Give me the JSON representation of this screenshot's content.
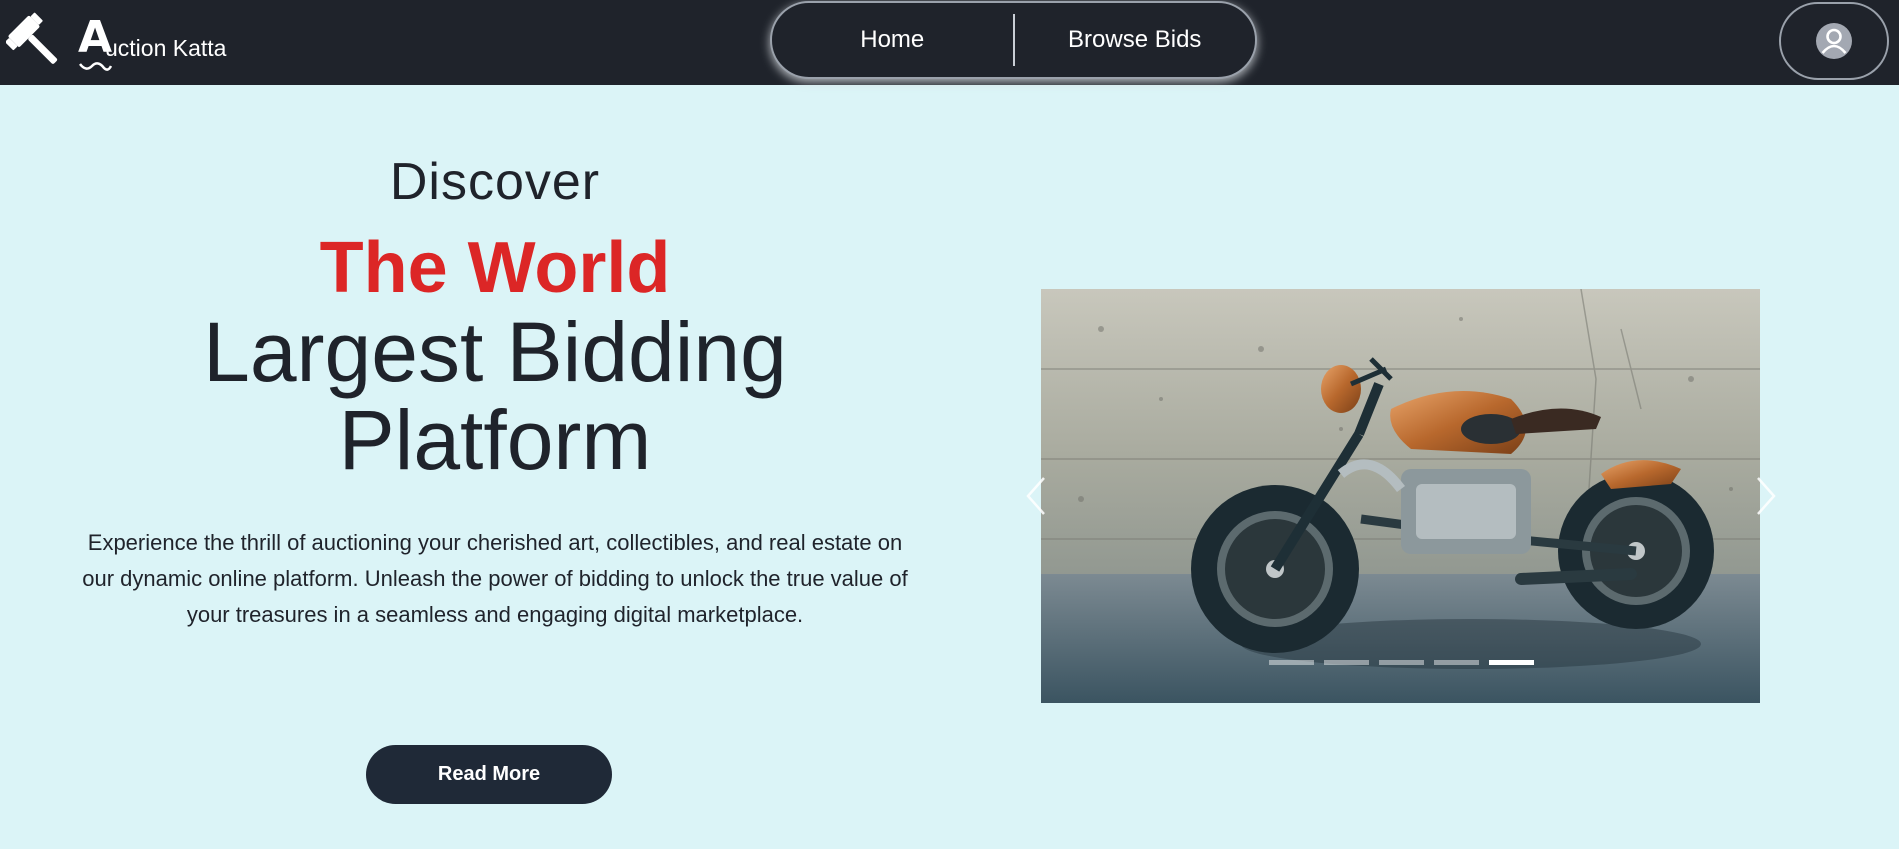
{
  "brand": {
    "logo_letter": "A",
    "name": "uction Katta",
    "gavel_icon": "gavel-icon"
  },
  "nav": {
    "links": [
      {
        "label": "Home"
      },
      {
        "label": "Browse Bids"
      }
    ],
    "profile_icon": "user-avatar-icon"
  },
  "hero": {
    "eyebrow": "Discover",
    "highlight": "The World",
    "headline_line1": "Largest Bidding",
    "headline_line2": "Platform",
    "description": "Experience the thrill of auctioning your cherished art, collectibles, and real estate on our dynamic online platform. Unleash the power of bidding to unlock the true value of your treasures in a seamless and engaging digital marketplace.",
    "cta_label": "Read More"
  },
  "carousel": {
    "slide_count": 5,
    "active_index": 4,
    "prev_icon": "chevron-left-icon",
    "next_icon": "chevron-right-icon"
  },
  "colors": {
    "navbar_bg": "#1f232b",
    "page_bg": "#dbf4f7",
    "accent_red": "#dc2626",
    "button_bg": "#1f2937"
  }
}
